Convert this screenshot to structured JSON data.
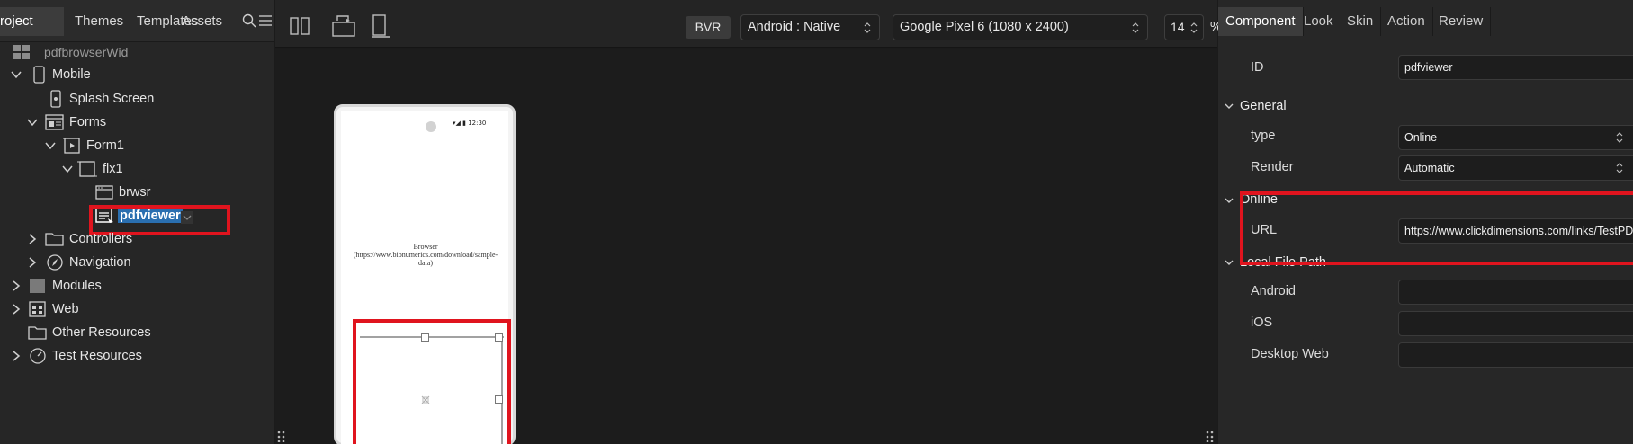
{
  "left_panel": {
    "tabs": [
      {
        "label": "roject",
        "active": true
      },
      {
        "label": "Themes"
      },
      {
        "label": "Templates"
      },
      {
        "label": "Assets"
      }
    ],
    "project_name": "pdfbrowserWid",
    "tree": {
      "mobile": "Mobile",
      "splash": "Splash Screen",
      "forms": "Forms",
      "form1": "Form1",
      "flx1": "flx1",
      "brwsr": "brwsr",
      "pdfviewer": "pdfviewer",
      "controllers": "Controllers",
      "navigation": "Navigation",
      "modules": "Modules",
      "web": "Web",
      "other_resources": "Other Resources",
      "test_resources": "Test Resources"
    }
  },
  "toolbar": {
    "bvr_label": "BVR",
    "platform": "Android : Native",
    "device": "Google Pixel 6 (1080 x 2400)",
    "zoom": "14",
    "zoom_unit": "%"
  },
  "canvas": {
    "status_time": "12:30",
    "browser_text": "Browser (https://www.bionumerics.com/download/sample-data)"
  },
  "right_panel": {
    "tabs": [
      {
        "label": "Component",
        "active": true
      },
      {
        "label": "Look"
      },
      {
        "label": "Skin"
      },
      {
        "label": "Action"
      },
      {
        "label": "Review"
      }
    ],
    "id_label": "ID",
    "id_value": "pdfviewer",
    "general_title": "General",
    "type_label": "type",
    "type_value": "Online",
    "render_label": "Render",
    "render_value": "Automatic",
    "online_title": "Online",
    "url_label": "URL",
    "url_value": "https://www.clickdimensions.com/links/TestPDFfile.pdf",
    "local_title": "Local File Path",
    "android_label": "Android",
    "ios_label": "iOS",
    "desktop_label": "Desktop Web"
  },
  "colors": {
    "highlight_red": "#e0141e",
    "selection_blue": "#2a6fb0"
  }
}
